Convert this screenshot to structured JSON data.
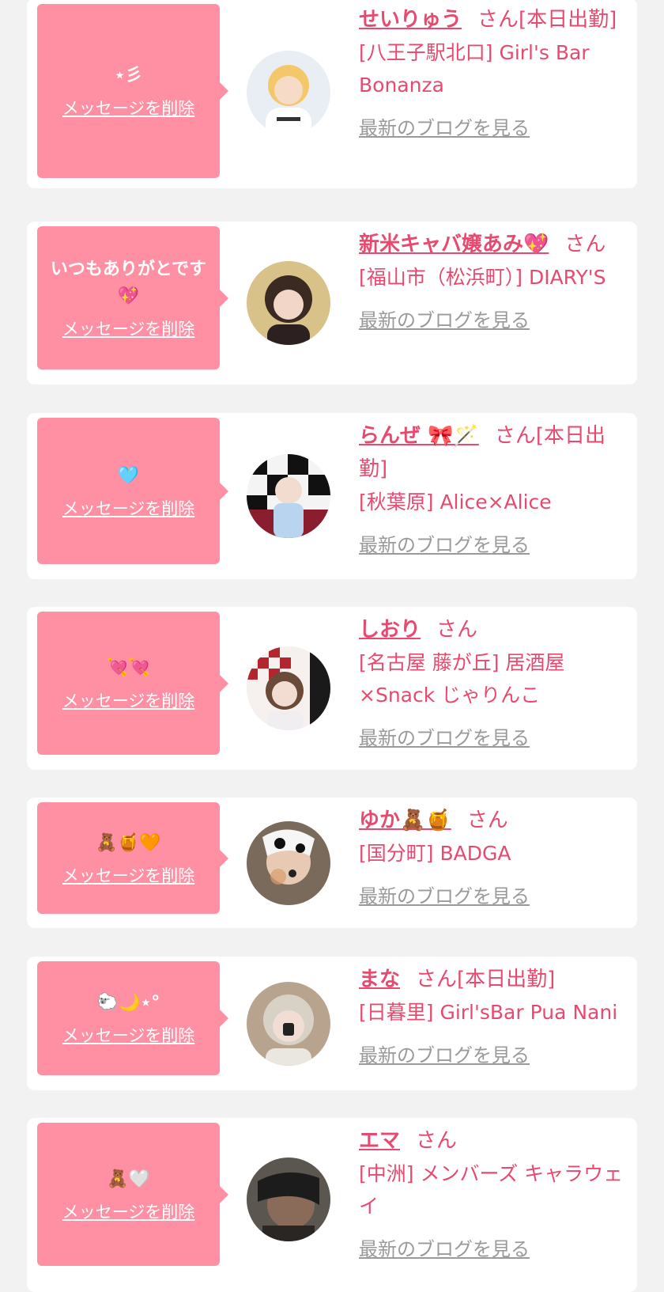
{
  "common": {
    "delete_label": "メッセージを削除",
    "san_label": "さん",
    "blog_label": "最新のブログを見る"
  },
  "colors": {
    "page_bg": "#f2f2f2",
    "bubble": "#ff8fa3",
    "accent": "#e84a6f",
    "muted": "#9a9a9a"
  },
  "entries": [
    {
      "message": "⋆彡",
      "name": "せいりゅう",
      "status": "[本日出勤]",
      "shop": "[八王子駅北口] Girl's Bar Bonanza"
    },
    {
      "message": "いつもありがとです💖",
      "name": "新米キャバ嬢あみ💖",
      "status": "",
      "shop": "[福山市（松浜町）] DIARY'S"
    },
    {
      "message": "🩵",
      "name": "らんぜ 🎀🪄",
      "status": "[本日出勤]",
      "shop": "[秋葉原] Alice×Alice"
    },
    {
      "message": "💘💘",
      "name": "しおり",
      "status": "",
      "shop": "[名古屋 藤が丘] 居酒屋×Snack じゃりんこ"
    },
    {
      "message": "🧸🍯🧡",
      "name": "ゆか🧸🍯",
      "status": "",
      "shop": "[国分町] BADGA"
    },
    {
      "message": "🐑🌙⋆°",
      "name": "まな",
      "status": "[本日出勤]",
      "shop": "[日暮里] Girl'sBar Pua Nani"
    },
    {
      "message": "🧸🤍",
      "name": "エマ",
      "status": "",
      "shop": "[中洲] メンバーズ キャラウェイ"
    }
  ]
}
